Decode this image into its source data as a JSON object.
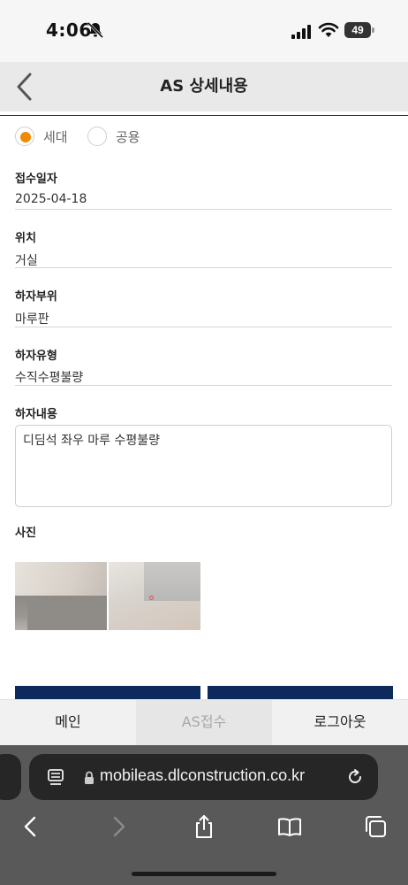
{
  "status_bar": {
    "time": "4:06",
    "battery": "49"
  },
  "header": {
    "title": "AS 상세내용"
  },
  "radios": [
    {
      "label": "세대",
      "selected": true
    },
    {
      "label": "공용",
      "selected": false
    }
  ],
  "fields": {
    "receipt_date": {
      "label": "접수일자",
      "value": "2025-04-18"
    },
    "location": {
      "label": "위치",
      "value": "거실"
    },
    "defect_part": {
      "label": "하자부위",
      "value": "마루판"
    },
    "defect_type": {
      "label": "하자유형",
      "value": "수직수평불량"
    },
    "defect_content": {
      "label": "하자내용",
      "value": "디딤석 좌우 마루 수평불량"
    }
  },
  "photos": {
    "label": "사진",
    "count": 2
  },
  "bottom_nav": {
    "main": "메인",
    "as_receipt": "AS접수",
    "logout": "로그아웃"
  },
  "browser": {
    "url": "mobileas.dlconstruction.co.kr"
  },
  "colors": {
    "radio_selected": "#f08a00",
    "action_button": "#0d2a5c",
    "header_bg": "#e9e9e9"
  }
}
